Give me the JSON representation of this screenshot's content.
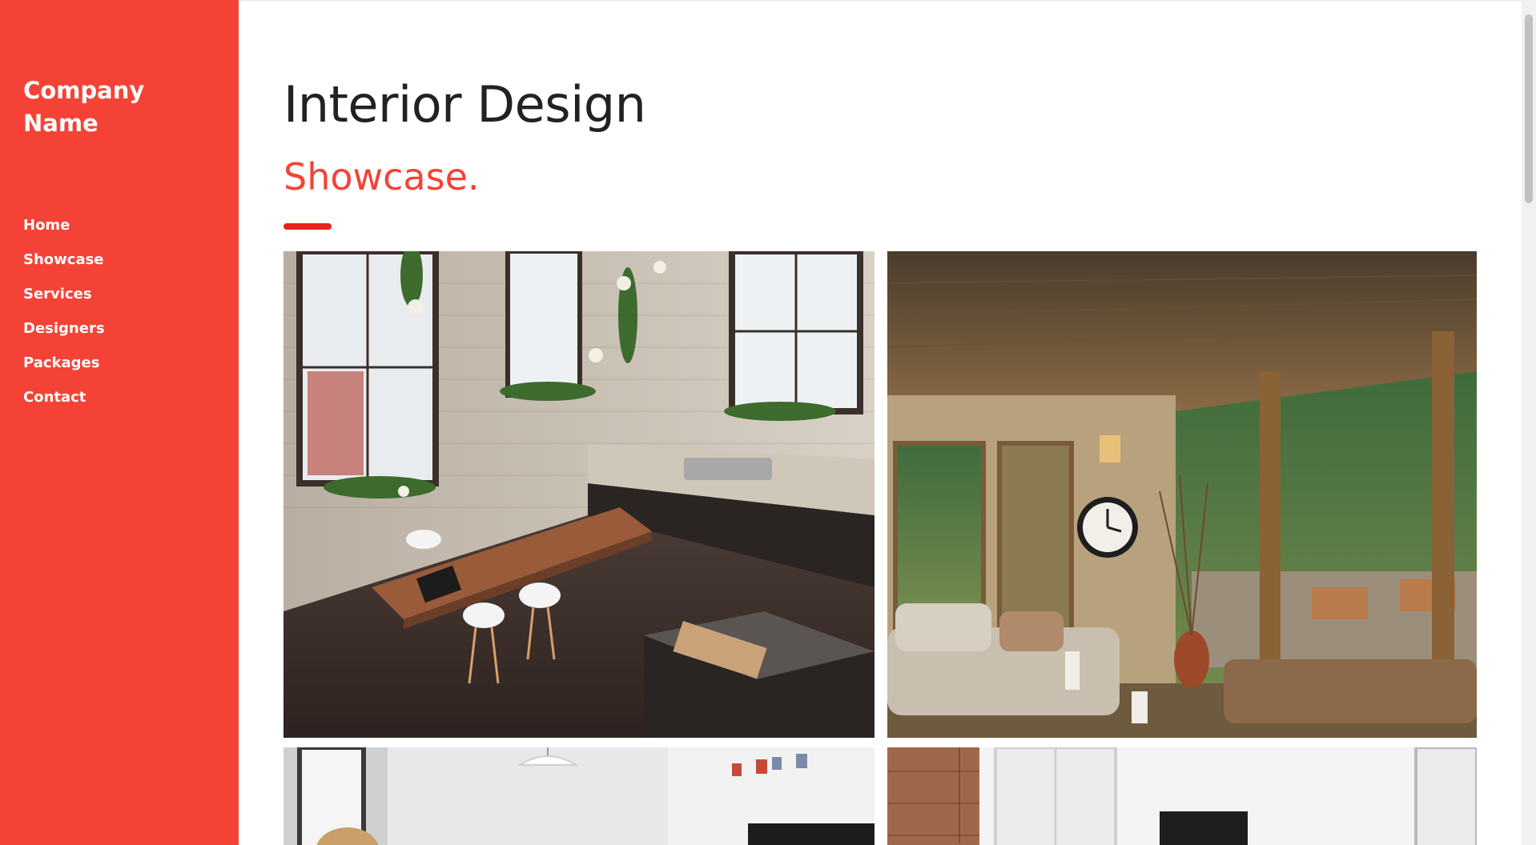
{
  "sidebar": {
    "brand": "Company Name",
    "nav": [
      {
        "label": "Home"
      },
      {
        "label": "Showcase"
      },
      {
        "label": "Services"
      },
      {
        "label": "Designers"
      },
      {
        "label": "Packages"
      },
      {
        "label": "Contact"
      }
    ]
  },
  "main": {
    "title": "Interior Design",
    "subtitle": "Showcase."
  },
  "colors": {
    "accent": "#f44336",
    "divider": "#e8221b",
    "heading": "#222222"
  }
}
